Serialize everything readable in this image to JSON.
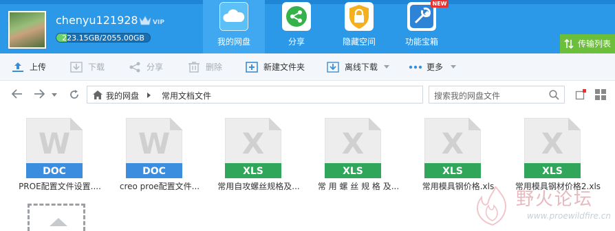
{
  "header": {
    "username": "chenyu121928",
    "vip_badge": "VIP",
    "quota": "223.15GB/2055.00GB",
    "quota_fraction": 0.109,
    "nav": [
      {
        "label": "我的网盘",
        "icon": "cloud-icon",
        "active": true
      },
      {
        "label": "分享",
        "icon": "share-icon"
      },
      {
        "label": "隐藏空间",
        "icon": "lock-icon"
      },
      {
        "label": "功能宝箱",
        "icon": "toolbox-icon",
        "badge": "NEW"
      }
    ],
    "transfer_list": "传输列表"
  },
  "toolbar": {
    "upload": "上传",
    "download": "下载",
    "share": "分享",
    "delete": "删除",
    "new_folder": "新建文件夹",
    "offline_download": "离线下载",
    "more": "更多"
  },
  "address": {
    "crumbs": [
      "我的网盘",
      "常用文档文件"
    ],
    "search_placeholder": "搜索我的网盘文件"
  },
  "files": [
    {
      "name": "PROE配置文件设置....",
      "type": "DOC",
      "letter": "W"
    },
    {
      "name": "creo proe配置文件...",
      "type": "DOC",
      "letter": "W"
    },
    {
      "name": "常用自攻螺丝规格及...",
      "type": "XLS",
      "letter": "X"
    },
    {
      "name": "常 用 螺 丝 规 格 及...",
      "type": "XLS",
      "letter": "X"
    },
    {
      "name": "常用模具钢价格.xls",
      "type": "XLS",
      "letter": "X"
    },
    {
      "name": "常用模具钢材价格2.xls",
      "type": "XLS",
      "letter": "X"
    }
  ],
  "watermark": {
    "text": "野火论坛",
    "url": "www.proewildfire.cn"
  },
  "colors": {
    "header_blue": "#2c98e8",
    "doc_blue": "#3b8de0",
    "xls_green": "#2fa65a",
    "transfer_green": "#6cbf3a"
  }
}
